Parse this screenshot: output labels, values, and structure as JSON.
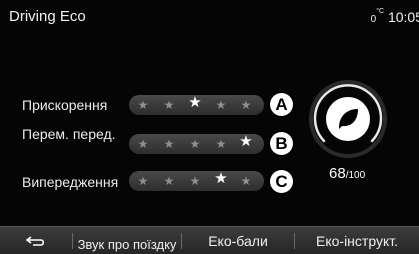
{
  "header": {
    "title": "Driving Eco",
    "temperature": "0",
    "temp_unit": "°C",
    "time": "10:05"
  },
  "rows": [
    {
      "label": "Прискорення",
      "badge": "A",
      "stars_on": 3,
      "stars_total": 5
    },
    {
      "label": "Перем. перед.",
      "badge": "B",
      "stars_on": 5,
      "stars_total": 5
    },
    {
      "label": "Випередження",
      "badge": "C",
      "stars_on": 4,
      "stars_total": 5
    }
  ],
  "score": {
    "value": "68",
    "max": "/100",
    "icon": "leaf-icon"
  },
  "bottom_bar": {
    "back_icon": "back-arrow-icon",
    "trip_sound": "Звук про поїздку",
    "eco_points": "Еко-бали",
    "eco_tutorial": "Еко-інструкт."
  },
  "colors": {
    "background": "#050505",
    "track": "#3a3a3a",
    "star_off": "#8f8f8f",
    "star_on": "#ffffff"
  }
}
